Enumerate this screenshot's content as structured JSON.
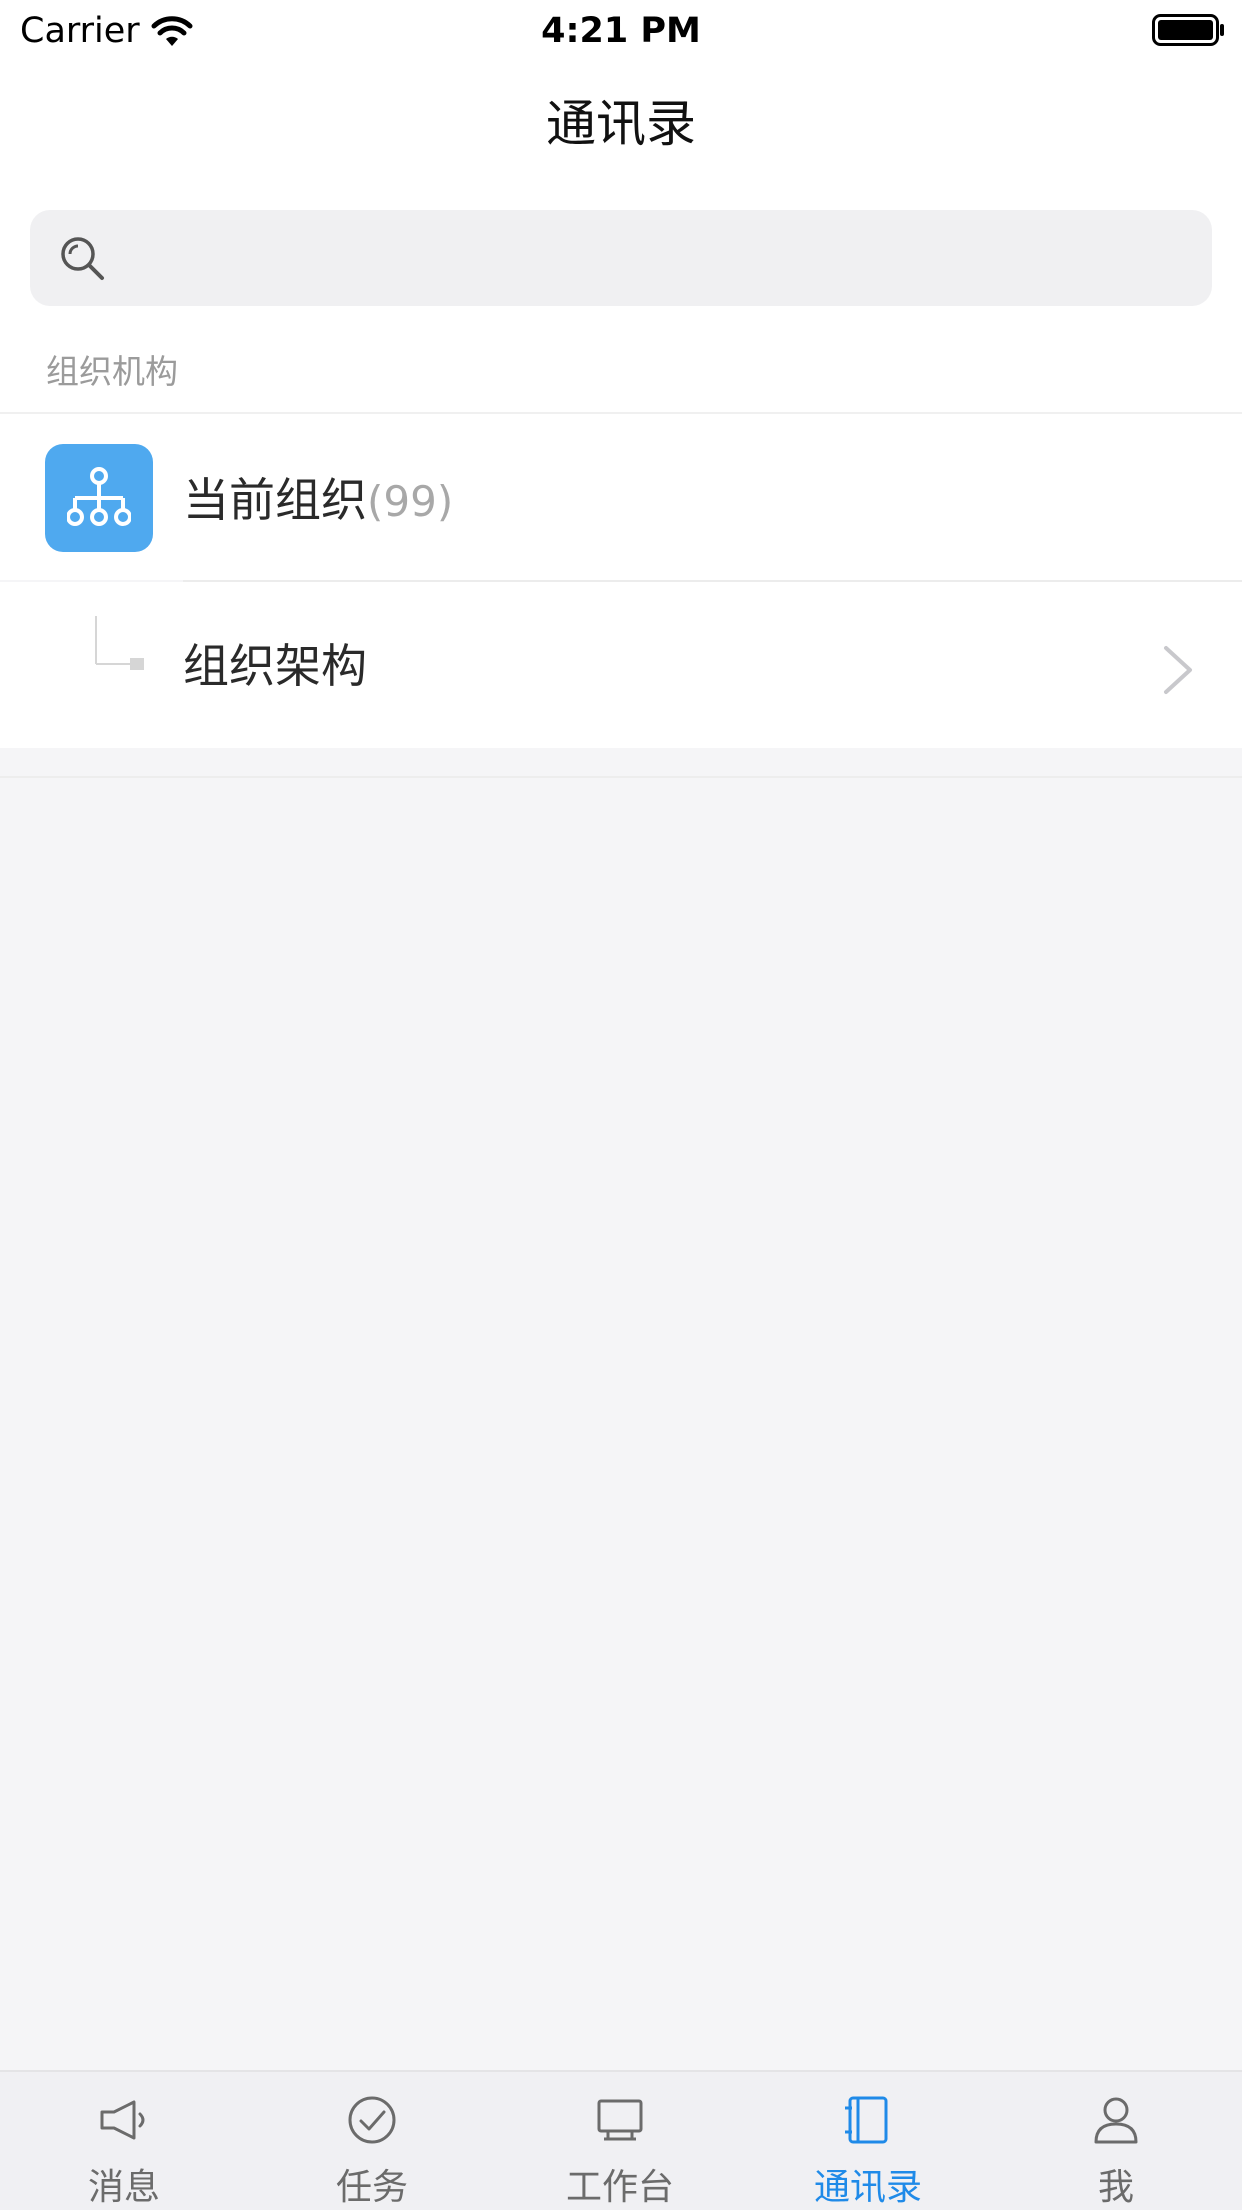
{
  "status_bar": {
    "carrier": "Carrier",
    "time": "4:21 PM",
    "wifi_icon": "wifi-icon",
    "battery_icon": "battery-icon"
  },
  "header": {
    "title": "通讯录"
  },
  "search": {
    "icon": "search-icon",
    "placeholder": "",
    "value": ""
  },
  "section": {
    "title": "组织机构"
  },
  "current_org": {
    "label": "当前组织",
    "count": "(99)",
    "icon": "org-chart-icon",
    "icon_bg_color": "#4fa9ef"
  },
  "structure_row": {
    "label": "组织架构",
    "connector_icon": "tree-connector-icon",
    "chevron_icon": "chevron-right-icon"
  },
  "tabbar": {
    "active_color": "#1f8ae8",
    "inactive_color": "#6b6b6b",
    "items": [
      {
        "label": "消息",
        "icon": "megaphone-icon",
        "active": false
      },
      {
        "label": "任务",
        "icon": "check-circle-icon",
        "active": false
      },
      {
        "label": "工作台",
        "icon": "monitor-icon",
        "active": false
      },
      {
        "label": "通讯录",
        "icon": "contacts-book-icon",
        "active": true
      },
      {
        "label": "我",
        "icon": "person-icon",
        "active": false
      }
    ]
  }
}
